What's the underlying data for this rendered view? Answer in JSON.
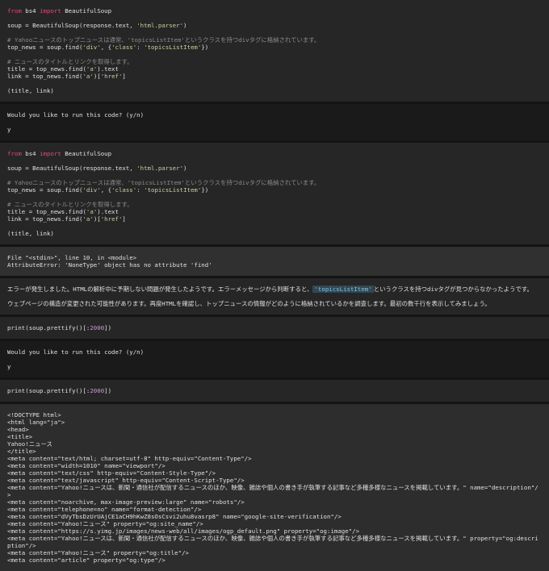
{
  "blocks": [
    {
      "type": "code",
      "name": "code-block-1",
      "lines": [
        [
          {
            "t": "from",
            "c": "kw"
          },
          {
            "t": " bs4 "
          },
          {
            "t": "import",
            "c": "kw"
          },
          {
            "t": " BeautifulSoup"
          }
        ],
        [],
        [
          {
            "t": "soup = BeautifulSoup(response.text, "
          },
          {
            "t": "'html.parser'",
            "c": "str"
          },
          {
            "t": ")"
          }
        ],
        [],
        [
          {
            "t": "# Yahooニュースのトップニュースは通常、'topicsListItem'というクラスを持つdivタグに格納されています。",
            "c": "cm"
          }
        ],
        [
          {
            "t": "top_news = soup.find("
          },
          {
            "t": "'div'",
            "c": "str"
          },
          {
            "t": ", {"
          },
          {
            "t": "'class'",
            "c": "str"
          },
          {
            "t": ": "
          },
          {
            "t": "'topicsListItem'",
            "c": "str"
          },
          {
            "t": "})"
          }
        ],
        [],
        [
          {
            "t": "# ニュースのタイトルとリンクを取得します。",
            "c": "cm"
          }
        ],
        [
          {
            "t": "title = top_news.find("
          },
          {
            "t": "'a'",
            "c": "str"
          },
          {
            "t": ").text"
          }
        ],
        [
          {
            "t": "link = top_news.find("
          },
          {
            "t": "'a'",
            "c": "str"
          },
          {
            "t": ")["
          },
          {
            "t": "'href'",
            "c": "str"
          },
          {
            "t": "]"
          }
        ],
        [],
        [
          {
            "t": "(title, link)"
          }
        ]
      ]
    },
    {
      "type": "prompt",
      "name": "confirm-prompt-1",
      "lines": [
        [
          {
            "t": "Would you like to run this code? (y/n)"
          }
        ],
        [],
        [
          {
            "t": "y"
          }
        ]
      ]
    },
    {
      "type": "code",
      "name": "code-block-2",
      "lines": [
        [
          {
            "t": "from",
            "c": "kw"
          },
          {
            "t": " bs4 "
          },
          {
            "t": "import",
            "c": "kw"
          },
          {
            "t": " BeautifulSoup"
          }
        ],
        [],
        [
          {
            "t": "soup = BeautifulSoup(response.text, "
          },
          {
            "t": "'html.parser'",
            "c": "str"
          },
          {
            "t": ")"
          }
        ],
        [],
        [
          {
            "t": "# Yahooニュースのトップニュースは通常、'topicsListItem'というクラスを持つdivタグに格納されています。",
            "c": "cm"
          }
        ],
        [
          {
            "t": "top_news = soup.find("
          },
          {
            "t": "'div'",
            "c": "str"
          },
          {
            "t": ", {"
          },
          {
            "t": "'class'",
            "c": "str"
          },
          {
            "t": ": "
          },
          {
            "t": "'topicsListItem'",
            "c": "str"
          },
          {
            "t": "})"
          }
        ],
        [],
        [
          {
            "t": "# ニュースのタイトルとリンクを取得します。",
            "c": "cm"
          }
        ],
        [
          {
            "t": "title = top_news.find("
          },
          {
            "t": "'a'",
            "c": "str"
          },
          {
            "t": ").text"
          }
        ],
        [
          {
            "t": "link = top_news.find("
          },
          {
            "t": "'a'",
            "c": "str"
          },
          {
            "t": ")["
          },
          {
            "t": "'href'",
            "c": "str"
          },
          {
            "t": "]"
          }
        ],
        [],
        [
          {
            "t": "(title, link)"
          }
        ]
      ]
    },
    {
      "type": "err",
      "name": "error-output",
      "lines": [
        [
          {
            "t": "File \"<stdin>\", line 10, in <module>"
          }
        ],
        [
          {
            "t": "AttributeError: 'NoneType' object has no attribute 'find'"
          }
        ]
      ]
    },
    {
      "type": "msg",
      "name": "assistant-message",
      "wrap": true,
      "lines": [
        [
          {
            "t": "エラーが発生しました。HTMLの解析中に予期しない問題が発生したようです。エラーメッセージから判断すると、"
          },
          {
            "t": "'topicsListItem'",
            "c": "code-hl"
          },
          {
            "t": "というクラスを持つdivタグが見つからなかったようです。"
          }
        ],
        [],
        [
          {
            "t": "ウェブページの構造が変更された可能性があります。再度HTMLを確認し、トップニュースの情報がどのように格納されているかを調査します。最初の数千行を表示してみましょう。"
          }
        ]
      ]
    },
    {
      "type": "code",
      "name": "code-block-3",
      "lines": [
        [
          {
            "t": "print(soup.prettify()[:"
          },
          {
            "t": "2000",
            "c": "num"
          },
          {
            "t": "])"
          }
        ]
      ]
    },
    {
      "type": "prompt",
      "name": "confirm-prompt-2",
      "lines": [
        [
          {
            "t": "Would you like to run this code? (y/n)"
          }
        ],
        [],
        [
          {
            "t": "y"
          }
        ]
      ]
    },
    {
      "type": "code",
      "name": "code-block-4",
      "lines": [
        [
          {
            "t": "print(soup.prettify()[:"
          },
          {
            "t": "2000",
            "c": "num"
          },
          {
            "t": "])"
          }
        ]
      ]
    },
    {
      "type": "out",
      "name": "html-output",
      "wrap": true,
      "lines": [
        [
          {
            "t": "<!DOCTYPE html>"
          }
        ],
        [
          {
            "t": "<html lang=\"ja\">"
          }
        ],
        [
          {
            "t": "<head>"
          }
        ],
        [
          {
            "t": "<title>"
          }
        ],
        [
          {
            "t": "Yahoo!ニュース"
          }
        ],
        [
          {
            "t": "</title>"
          }
        ],
        [
          {
            "t": "<meta content=\"text/html; charset=utf-8\" http-equiv=\"Content-Type\"/>"
          }
        ],
        [
          {
            "t": "<meta content=\"width=1010\" name=\"viewport\"/>"
          }
        ],
        [
          {
            "t": "<meta content=\"text/css\" http-equiv=\"Content-Style-Type\"/>"
          }
        ],
        [
          {
            "t": "<meta content=\"text/javascript\" http-equiv=\"Content-Script-Type\"/>"
          }
        ],
        [
          {
            "t": "<meta content=\"Yahoo!ニュースは、新聞・通信社が配信するニュースのほか、映像、雑誌や個人の書き手が執筆する記事など多種多様なニュースを掲載しています。\" name=\"description\"/>"
          }
        ],
        [
          {
            "t": "<meta content=\"noarchive, max-image-preview:large\" name=\"robots\"/>"
          }
        ],
        [
          {
            "t": "<meta content=\"telephone=no\" name=\"format-detection\"/>"
          }
        ],
        [
          {
            "t": "<meta content=\"dVyTbsDzUrUAjCE1aCH9hKwZ8sOsCsvi2uhu8vasrp8\" name=\"google-site-verification\"/>"
          }
        ],
        [
          {
            "t": "<meta content=\"Yahoo!ニュース\" property=\"og:site_name\"/>"
          }
        ],
        [
          {
            "t": "<meta content=\"https://s.yimg.jp/images/news-web/all/images/ogp_default.png\" property=\"og:image\"/>"
          }
        ],
        [
          {
            "t": "<meta content=\"Yahoo!ニュースは、新聞・通信社が配信するニュースのほか、映像、雑誌や個人の書き手が執筆する記事など多種多様なニュースを掲載しています。\" property=\"og:description\"/>"
          }
        ],
        [
          {
            "t": "<meta content=\"Yahoo!ニュース\" property=\"og:title\"/>"
          }
        ],
        [
          {
            "t": "<meta content=\"article\" property=\"og:type\"/>"
          }
        ]
      ]
    }
  ]
}
